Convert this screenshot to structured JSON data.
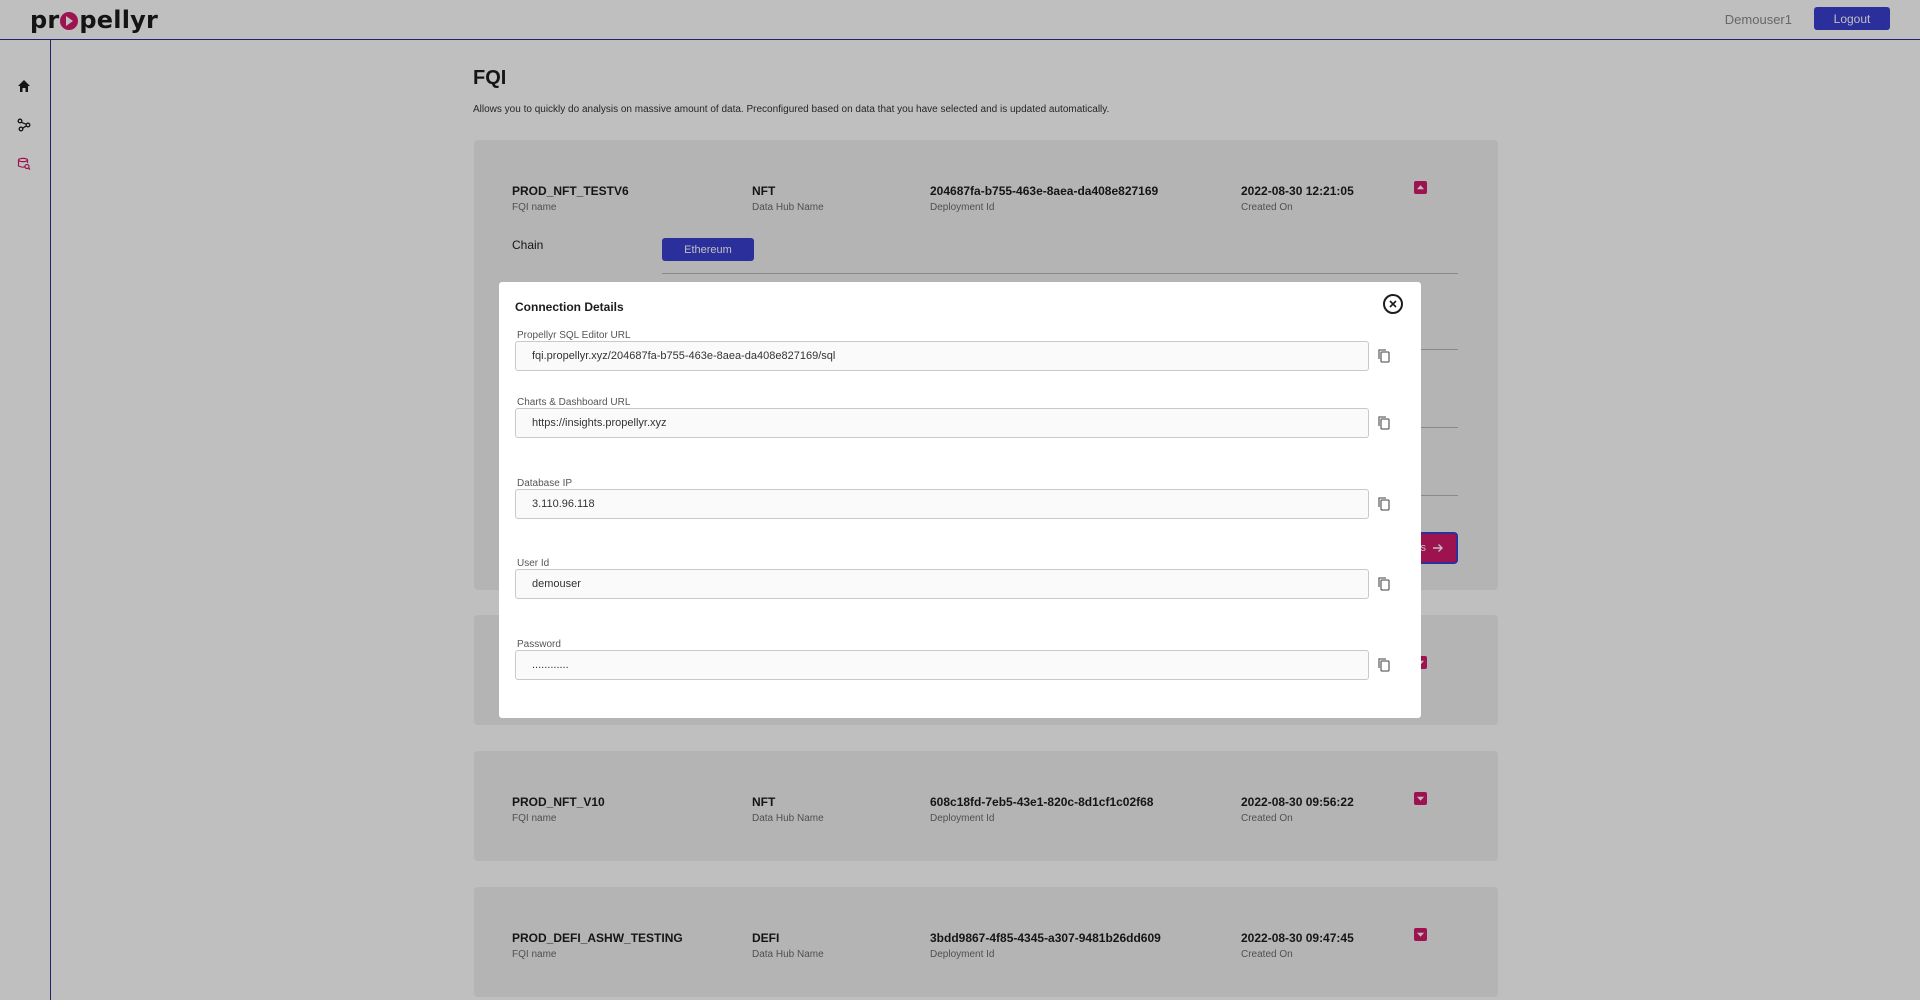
{
  "app": {
    "brand": "propellyr",
    "brand_prefix": "pr",
    "brand_suffix": "pellyr"
  },
  "header": {
    "user_name": "Demouser1",
    "logout_label": "Logout"
  },
  "sidebar": {
    "items": [
      {
        "icon": "home-icon"
      },
      {
        "icon": "hub-icon"
      },
      {
        "icon": "query-icon",
        "active": true
      }
    ]
  },
  "page": {
    "title": "FQI",
    "description": "Allows you to quickly do analysis on massive amount of data. Preconfigured based on data that you have selected and is updated automatically."
  },
  "labels": {
    "fqi_name": "FQI name",
    "data_hub": "Data Hub Name",
    "deployment": "Deployment Id",
    "created": "Created On",
    "chain": "Chain"
  },
  "cards": [
    {
      "name": "PROD_NFT_TESTV6",
      "hub": "NFT",
      "deployment_id": "204687fa-b755-463e-8aea-da408e827169",
      "created_on": "2022-08-30 12:21:05",
      "expanded": true,
      "chain_value": "Ethereum",
      "action_label": "s"
    },
    {
      "name": "",
      "hub": "",
      "deployment_id": "",
      "created_on": "",
      "expanded": false
    },
    {
      "name": "PROD_NFT_V10",
      "hub": "NFT",
      "deployment_id": "608c18fd-7eb5-43e1-820c-8d1cf1c02f68",
      "created_on": "2022-08-30 09:56:22",
      "expanded": false
    },
    {
      "name": "PROD_DEFI_ASHW_TESTING",
      "hub": "DEFI",
      "deployment_id": "3bdd9867-4f85-4345-a307-9481b26dd609",
      "created_on": "2022-08-30 09:47:45",
      "expanded": false
    }
  ],
  "modal": {
    "title": "Connection Details",
    "fields": [
      {
        "label": "Propellyr SQL Editor URL",
        "value": "fqi.propellyr.xyz/204687fa-b755-463e-8aea-da408e827169/sql"
      },
      {
        "label": "Charts & Dashboard URL",
        "value": "https://insights.propellyr.xyz"
      },
      {
        "label": "Database IP",
        "value": "3.110.96.118"
      },
      {
        "label": "User Id",
        "value": "demouser"
      },
      {
        "label": "Password",
        "value": "............"
      }
    ]
  },
  "colors": {
    "accent": "#3a3fcf",
    "brand": "#d01a6b"
  }
}
